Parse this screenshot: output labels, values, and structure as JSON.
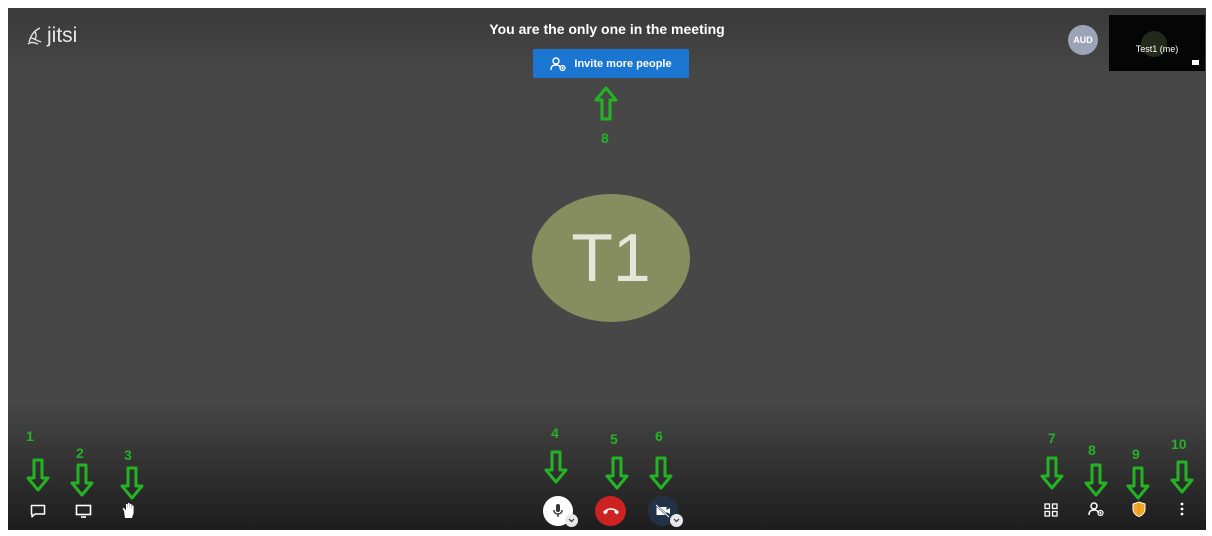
{
  "app": {
    "logo_text": "jitsi"
  },
  "meeting": {
    "message": "You are the only one in the meeting",
    "invite_label": "Invite more people",
    "speaker_initials": "T1"
  },
  "filmstrip": {
    "audio_badge": "AUD",
    "self_name": "Test1 (me)"
  },
  "toolbar": {
    "items": [
      {
        "name": "chat",
        "icon": "chat-bubble-icon"
      },
      {
        "name": "screen-share",
        "icon": "monitor-icon"
      },
      {
        "name": "raise-hand",
        "icon": "hand-icon"
      },
      {
        "name": "microphone",
        "icon": "microphone-icon"
      },
      {
        "name": "hang-up",
        "icon": "phone-hangup-icon"
      },
      {
        "name": "camera",
        "icon": "camera-off-icon"
      },
      {
        "name": "tile-view",
        "icon": "grid-icon"
      },
      {
        "name": "invite",
        "icon": "add-person-icon"
      },
      {
        "name": "security",
        "icon": "shield-icon"
      },
      {
        "name": "more",
        "icon": "more-vertical-icon"
      }
    ]
  },
  "annotations": {
    "labels": [
      "1",
      "2",
      "3",
      "4",
      "5",
      "6",
      "7",
      "8",
      "9",
      "10"
    ],
    "invite_label_number": "8",
    "color": "#24b324"
  },
  "colors": {
    "meeting_background": "#474747",
    "invite_button": "#1b76d1",
    "hangup_button": "#cc2222",
    "avatar": "#868d5e",
    "security_shield": "#f5a623"
  }
}
